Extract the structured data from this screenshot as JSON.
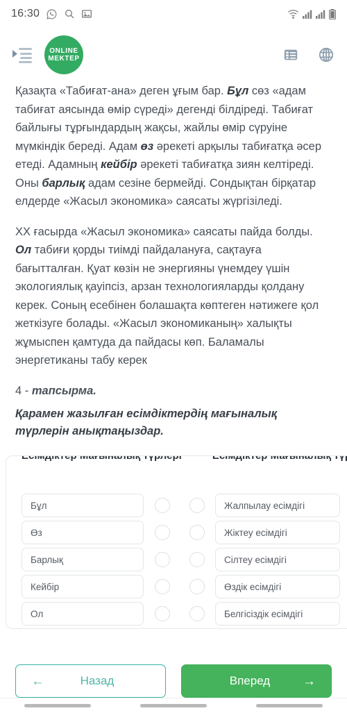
{
  "status_bar": {
    "time": "16:30",
    "left_icons": [
      "whatsapp-icon",
      "search-icon",
      "gallery-icon"
    ],
    "right_icons": [
      "wifi-icon",
      "signal-icon-1",
      "signal-icon-2",
      "battery-icon"
    ]
  },
  "header": {
    "menu_icon": "indent-menu-icon",
    "logo_line1": "ONLINE",
    "logo_line2": "MEKTEP",
    "logo_color": "#33ab63",
    "list_icon": "list-view-icon",
    "globe_icon": "globe-language-icon"
  },
  "content": {
    "paragraph_1": {
      "s1": "Қазақта «Табиғат-ана» деген ұғым бар. ",
      "b1": "Бұл",
      "s2": " сөз «адам табиғат аясында өмір сүреді» дегенді білдіреді. Табиғат байлығы тұрғындардың жақсы, жайлы өмір сүруіне мүмкіндік береді. Адам ",
      "b2": "өз",
      "s3": " әрекеті арқылы табиғатқа әсер етеді. Адамның ",
      "b3": "кейбір",
      "s4": " әрекеті табиғатқа зиян келтіреді. Оны ",
      "b4": "барлық",
      "s5": " адам сезіне бермейді. Сондықтан бірқатар елдерде «Жасыл экономика» саясаты жүргізіледі."
    },
    "paragraph_2": {
      "s1": "ХХ ғасырда «Жасыл экономика» саясаты пайда болды. ",
      "b1": "Ол",
      "s2": " табиғи қорды тиімді пайдалануға, сақтауға бағытталған. Қуат көзін не энергияны үнемдеу үшін экологиялық қауіпсіз, арзан технологияларды қолдану керек. Соның есебінен болашақта көптеген нәтижеге қол жеткізуге болады. «Жасыл экономиканың» халықты жұмыспен қамтуда да пайдасы көп. Баламалы энергетиканы табу керек"
    },
    "task_number_prefix": "4 - ",
    "task_number_word": "тапсырма.",
    "task_instruction": "Қарамен жазылған есімдіктердің мағыналық түрлерін анықтаңыздар."
  },
  "matching": {
    "clipped_header_left": "Есімдіктер Мағыналық түрлері",
    "clipped_header_right": "Есімдіктер Мағыналық түрлері",
    "left_items": [
      "Бұл",
      "Өз",
      "Барлық",
      "Кейбір",
      "Ол"
    ],
    "right_items": [
      "Жалпылау есімдігі",
      "Жіктеу есімдігі",
      "Сілтеу есімдігі",
      "Өздік есімдігі",
      "Белгісіздік есімдігі"
    ]
  },
  "footer": {
    "back_label": "Назад",
    "back_arrow": "←",
    "back_color": "#4fb6a8",
    "next_label": "Вперед",
    "next_arrow": "→",
    "next_color": "#45b35c"
  }
}
